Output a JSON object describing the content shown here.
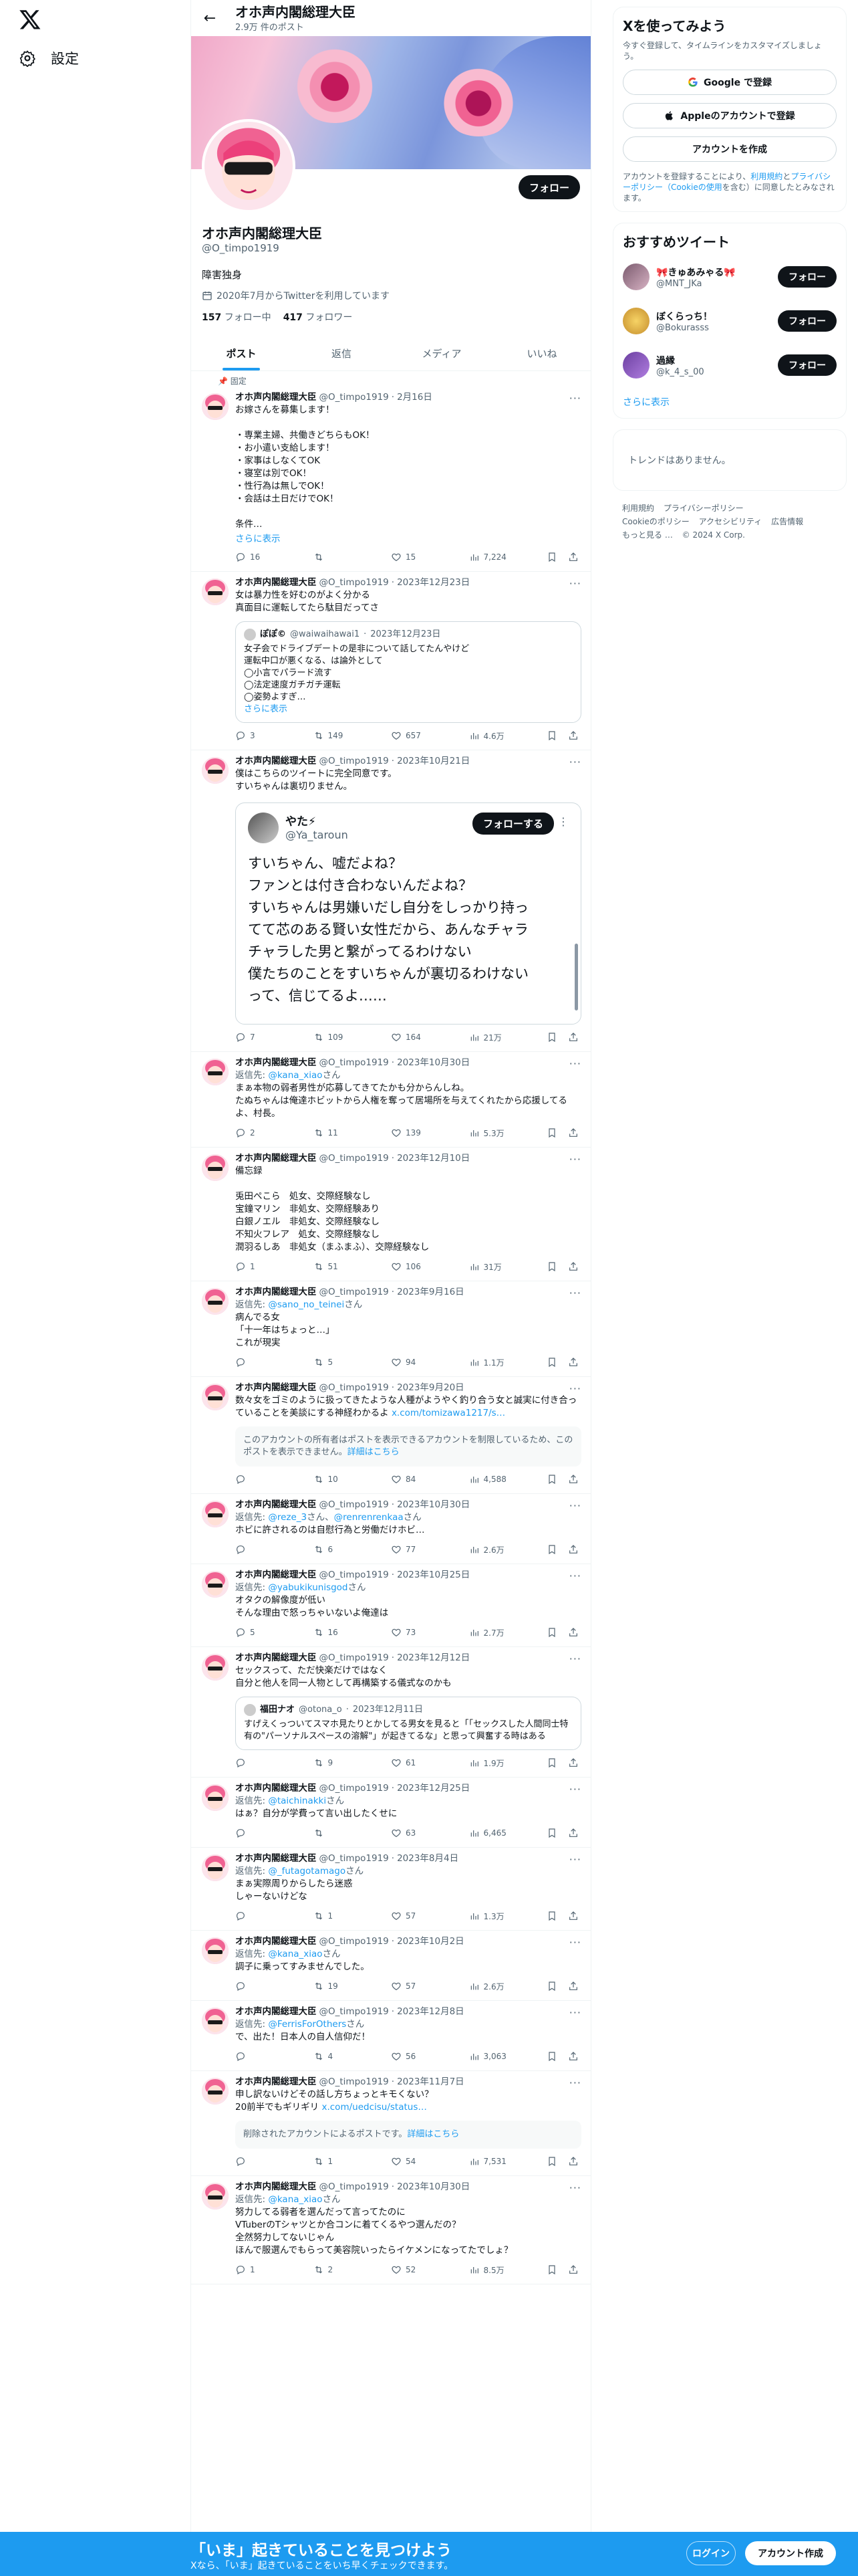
{
  "left_nav": {
    "settings_label": "設定"
  },
  "header": {
    "name": "オホ声内閣総理大臣",
    "post_count": "2.9万 件のポスト"
  },
  "profile": {
    "name": "オホ声内閣総理大臣",
    "handle": "@O_timpo1919",
    "bio": "障害独身",
    "joined": "2020年7月からTwitterを利用しています",
    "following_count": "157",
    "following_label": "フォロー中",
    "followers_count": "417",
    "followers_label": "フォロワー",
    "follow_button": "フォロー"
  },
  "tabs": [
    "ポスト",
    "返信",
    "メディア",
    "いいね"
  ],
  "pinned_label": "固定",
  "tweets": [
    {
      "name": "オホ声内閣総理大臣",
      "handle": "@O_timpo1919",
      "date": "2月16日",
      "text": "お嫁さんを募集します！\n\n・専業主婦、共働きどちらもOK！\n・お小遣い支給します！\n・家事はしなくてOK\n・寝室は別でOK！\n・性行為は無しでOK！\n・会話は土日だけでOK！\n\n条件…",
      "show_more": "さらに表示",
      "replies": "16",
      "reposts": "",
      "likes": "15",
      "views": "7,224"
    },
    {
      "name": "オホ声内閣総理大臣",
      "handle": "@O_timpo1919",
      "date": "2023年12月23日",
      "text": "女は暴力性を好むのがよく分かる\n真面目に運転してたら駄目だってさ",
      "quote": {
        "name": "ぽぽ©",
        "handle": "@waiwaihawai1",
        "date": "2023年12月23日",
        "text": "女子会でドライブデートの是非について話してたんやけど\n運転中口が悪くなる、は論外として\n◯小言でパラード流す\n◯法定速度ガチガチ運転\n◯姿勢よすぎ…",
        "show_more": "さらに表示"
      },
      "replies": "3",
      "reposts": "149",
      "likes": "657",
      "views": "4.6万"
    },
    {
      "name": "オホ声内閣総理大臣",
      "handle": "@O_timpo1919",
      "date": "2023年10月21日",
      "text": "僕はこちらのツイートに完全同意です。\nすいちゃんは裏切りません。",
      "embed": {
        "name": "やた⚡",
        "handle": "@Ya_taroun",
        "follow": "フォローする",
        "text": "すいちゃん、嘘だよね？\nファンとは付き合わないんだよね？\nすいちゃんは男嫌いだし自分をしっかり持っ\nてて芯のある賢い女性だから、あんなチャラ\nチャラした男と繋がってるわけない\n僕たちのことをすいちゃんが裏切るわけない\nって、信じてるよ……"
      },
      "replies": "7",
      "reposts": "109",
      "likes": "164",
      "views": "21万"
    },
    {
      "name": "オホ声内閣総理大臣",
      "handle": "@O_timpo1919",
      "date": "2023年10月30日",
      "reply_prefix": "返信先: ",
      "reply_to": "@kana_xiao",
      "reply_suffix": "さん",
      "text": "まぁ本物の弱者男性が応募してきてたかも分からんしね。\nたぬちゃんは俺達ホビットから人権を奪って居場所を与えてくれたから応援してるよ、村長。",
      "replies": "2",
      "reposts": "11",
      "likes": "139",
      "views": "5.3万"
    },
    {
      "name": "オホ声内閣総理大臣",
      "handle": "@O_timpo1919",
      "date": "2023年12月10日",
      "text": "備忘録\n\n兎田ぺこら　処女、交際経験なし\n宝鐘マリン　非処女、交際経験あり\n白銀ノエル　非処女、交際経験なし\n不知火フレア　処女、交際経験なし\n潤羽るしあ　非処女（まふまふ）、交際経験なし",
      "replies": "1",
      "reposts": "51",
      "likes": "106",
      "views": "31万"
    },
    {
      "name": "オホ声内閣総理大臣",
      "handle": "@O_timpo1919",
      "date": "2023年9月16日",
      "reply_prefix": "返信先: ",
      "reply_to": "@sano_no_teinei",
      "reply_suffix": "さん",
      "text": "病んでる女\n「十一年はちょっと…」\nこれが現実",
      "replies": "",
      "reposts": "5",
      "likes": "94",
      "views": "1.1万"
    },
    {
      "name": "オホ声内閣総理大臣",
      "handle": "@O_timpo1919",
      "date": "2023年9月20日",
      "text": "数々女をゴミのように扱ってきたような人種がようやく釣り合う女と誠実に付き合っていることを美談にする神経わかるよ ",
      "link": "x.com/tomizawa1217/s…",
      "notice": "このアカウントの所有者はポストを表示できるアカウントを制限しているため、このポストを表示できません。",
      "notice_link": "詳細はこちら",
      "replies": "",
      "reposts": "10",
      "likes": "84",
      "views": "4,588"
    },
    {
      "name": "オホ声内閣総理大臣",
      "handle": "@O_timpo1919",
      "date": "2023年10月30日",
      "reply_prefix": "返信先: ",
      "reply_to": "@reze_3",
      "reply_suffix": "さん、",
      "reply_to2": "@renrenrenkaa",
      "reply_suffix2": "さん",
      "text": "ホビに許されるのは自慰行為と労働だけホビ…",
      "replies": "",
      "reposts": "6",
      "likes": "77",
      "views": "2.6万"
    },
    {
      "name": "オホ声内閣総理大臣",
      "handle": "@O_timpo1919",
      "date": "2023年10月25日",
      "reply_prefix": "返信先: ",
      "reply_to": "@yabukikunisgod",
      "reply_suffix": "さん",
      "text": "オタクの解像度が低い\nそんな理由で怒っちゃいないよ俺達は",
      "replies": "5",
      "reposts": "16",
      "likes": "73",
      "views": "2.7万"
    },
    {
      "name": "オホ声内閣総理大臣",
      "handle": "@O_timpo1919",
      "date": "2023年12月12日",
      "text": "セックスって、ただ快楽だけではなく\n自分と他人を同一人物として再構築する儀式なのかも",
      "quote": {
        "name": "福田ナオ",
        "handle": "@otona_o",
        "date": "2023年12月11日",
        "text": "すげえくっついてスマホ見たりとかしてる男女を見ると「「セックスした人間同士特有の\"パーソナルスペースの溶解\"」が起きてるな」と思って興奮する時はある",
        "show_more": ""
      },
      "replies": "",
      "reposts": "9",
      "likes": "61",
      "views": "1.9万"
    },
    {
      "name": "オホ声内閣総理大臣",
      "handle": "@O_timpo1919",
      "date": "2023年12月25日",
      "reply_prefix": "返信先: ",
      "reply_to": "@taichinakki",
      "reply_suffix": "さん",
      "text": "はぁ？自分が学費って言い出したくせに",
      "replies": "",
      "reposts": "",
      "likes": "63",
      "views": "6,465"
    },
    {
      "name": "オホ声内閣総理大臣",
      "handle": "@O_timpo1919",
      "date": "2023年8月4日",
      "reply_prefix": "返信先: ",
      "reply_to": "@_futagotamago",
      "reply_suffix": "さん",
      "text": "まぁ実際周りからしたら迷惑\nしゃーないけどな",
      "replies": "",
      "reposts": "1",
      "likes": "57",
      "views": "1.3万"
    },
    {
      "name": "オホ声内閣総理大臣",
      "handle": "@O_timpo1919",
      "date": "2023年10月2日",
      "reply_prefix": "返信先: ",
      "reply_to": "@kana_xiao",
      "reply_suffix": "さん",
      "text": "調子に乗ってすみませんでした。",
      "replies": "",
      "reposts": "19",
      "likes": "57",
      "views": "2.6万"
    },
    {
      "name": "オホ声内閣総理大臣",
      "handle": "@O_timpo1919",
      "date": "2023年12月8日",
      "reply_prefix": "返信先: ",
      "reply_to": "@FerrisForOthers",
      "reply_suffix": "さん",
      "text": "で、出た！日本人の自人信仰だ！",
      "replies": "",
      "reposts": "4",
      "likes": "56",
      "views": "3,063"
    },
    {
      "name": "オホ声内閣総理大臣",
      "handle": "@O_timpo1919",
      "date": "2023年11月7日",
      "text": "申し訳ないけどその話し方ちょっとキモくない？\n20前半でもギリギリ ",
      "link": "x.com/uedcisu/status…",
      "notice": "削除されたアカウントによるポストです。",
      "notice_link": "詳細はこちら",
      "replies": "",
      "reposts": "1",
      "likes": "54",
      "views": "7,531"
    },
    {
      "name": "オホ声内閣総理大臣",
      "handle": "@O_timpo1919",
      "date": "2023年10月30日",
      "reply_prefix": "返信先: ",
      "reply_to": "@kana_xiao",
      "reply_suffix": "さん",
      "text": "努力してる弱者を選んだって言ってたのに\nVTuberのTシャツとか合コンに着てくるやつ選んだの？\n全然努力してないじゃん\nほんで服選んでもらって美容院いったらイケメンになってたでしょ？",
      "replies": "1",
      "reposts": "2",
      "likes": "52",
      "views": "8.5万"
    }
  ],
  "right": {
    "signup_title": "Xを使ってみよう",
    "signup_sub": "今すぐ登録して、タイムラインをカスタマイズしましょう。",
    "google_label": "Google で登録",
    "apple_label": "Appleのアカウントで登録",
    "create_label": "アカウントを作成",
    "legal_pre": "アカウントを登録することにより、",
    "legal_link1": "利用規約",
    "legal_mid": "と",
    "legal_link2": "プライバシーポリシー（Cookieの使用",
    "legal_post": "を含む）に同意したとみなされます。",
    "recommend_title": "おすすめツイート",
    "recommend": [
      {
        "name": "🎀きゅあみゃる🎀",
        "handle": "@MNT_JKa",
        "follow": "フォロー"
      },
      {
        "name": "ぼくらっち！",
        "handle": "@Bokurasss",
        "follow": "フォロー"
      },
      {
        "name": "過縁",
        "handle": "@k_4_s_00",
        "follow": "フォロー"
      }
    ],
    "show_more": "さらに表示",
    "trends_empty": "トレンドはありません。",
    "footer": [
      "利用規約",
      "プライバシーポリシー",
      "Cookieのポリシー",
      "アクセシビリティ",
      "広告情報",
      "もっと見る …",
      "© 2024 X Corp."
    ]
  },
  "bottom_bar": {
    "title": "「いま」起きていることを見つけよう",
    "subtitle": "Xなら、「いま」起きていることをいち早くチェックできます。",
    "login": "ログイン",
    "create": "アカウント作成"
  },
  "colors": {
    "accent": "#1d9bf0",
    "text": "#0f1419",
    "muted": "#536471"
  }
}
